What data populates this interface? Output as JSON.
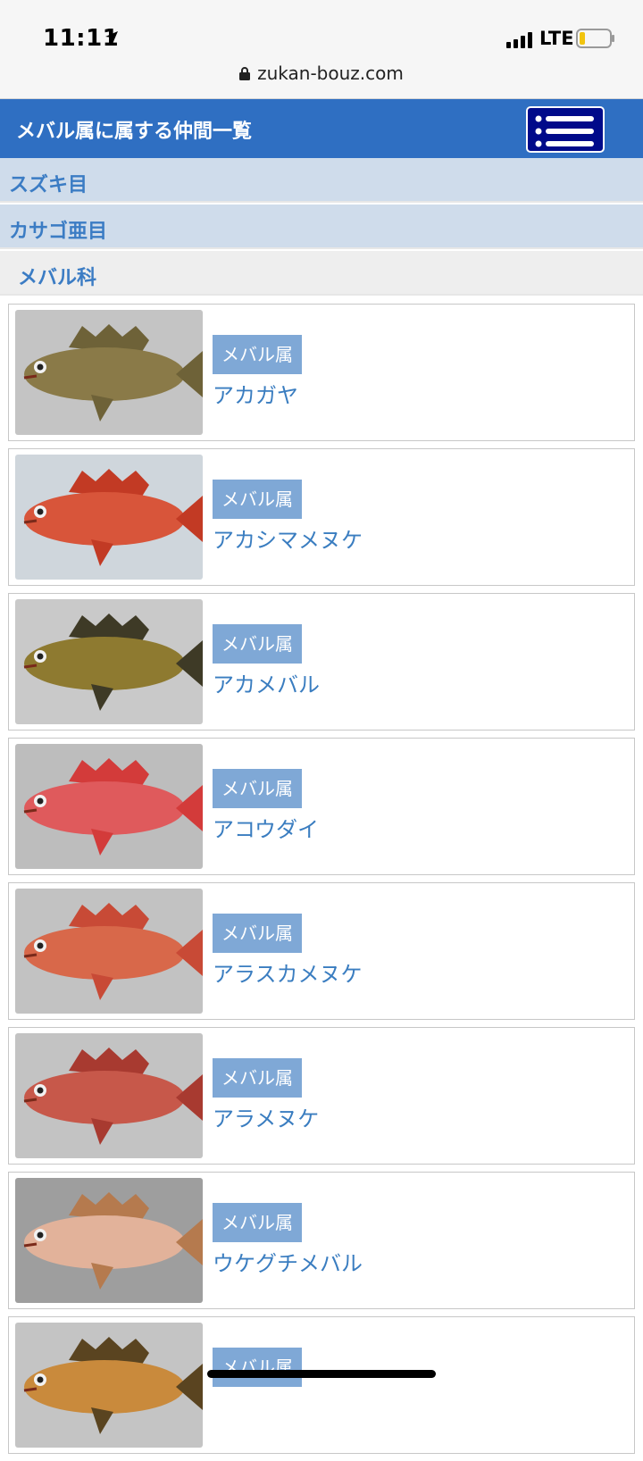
{
  "status_bar": {
    "time": "11:11",
    "network": "LTE"
  },
  "browser": {
    "url": "zukan-bouz.com"
  },
  "header": {
    "title": "メバル属に属する仲間一覧"
  },
  "breadcrumbs": [
    "スズキ目",
    "カサゴ亜目",
    "メバル科"
  ],
  "items": [
    {
      "tag": "メバル属",
      "name": "アカガヤ",
      "bg": "#c4c4c4",
      "color": "#8a7a48",
      "fin": "#6e6238"
    },
    {
      "tag": "メバル属",
      "name": "アカシマメヌケ",
      "bg": "#cfd6dc",
      "color": "#d8553a",
      "fin": "#c23a24"
    },
    {
      "tag": "メバル属",
      "name": "アカメバル",
      "bg": "#c9c9c9",
      "color": "#8e7a30",
      "fin": "#3e3a26"
    },
    {
      "tag": "メバル属",
      "name": "アコウダイ",
      "bg": "#bdbdbd",
      "color": "#df5a5c",
      "fin": "#d33b3a"
    },
    {
      "tag": "メバル属",
      "name": "アラスカメヌケ",
      "bg": "#c2c2c2",
      "color": "#d8684a",
      "fin": "#c84a36"
    },
    {
      "tag": "メバル属",
      "name": "アラメヌケ",
      "bg": "#c3c3c3",
      "color": "#c7584a",
      "fin": "#a83a30"
    },
    {
      "tag": "メバル属",
      "name": "ウケグチメバル",
      "bg": "#9e9e9e",
      "color": "#e2b29a",
      "fin": "#b57a4e"
    },
    {
      "tag": "メバル属",
      "name": "",
      "bg": "#c4c4c4",
      "color": "#c98a3c",
      "fin": "#5a4420"
    }
  ]
}
